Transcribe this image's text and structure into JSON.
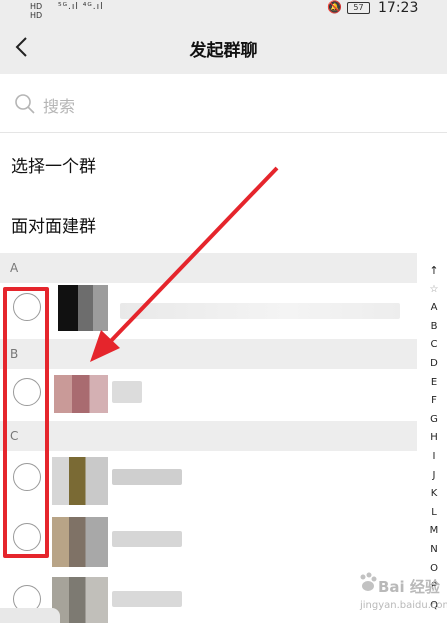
{
  "status_bar": {
    "left_labels": "HD\nHD",
    "signal": "⁵ᴳ.ıl ⁴ᴳ.ıl",
    "battery": "57",
    "time": "17:23"
  },
  "nav": {
    "title": "发起群聊"
  },
  "search": {
    "placeholder": "搜索"
  },
  "menu": {
    "select_group": "选择一个群",
    "face_to_face": "面对面建群"
  },
  "sections": [
    "A",
    "B",
    "C"
  ],
  "index_bar": [
    "↑",
    "☆",
    "A",
    "B",
    "C",
    "D",
    "E",
    "F",
    "G",
    "H",
    "I",
    "J",
    "K",
    "L",
    "M",
    "N",
    "O",
    "P",
    "Q"
  ],
  "watermark": {
    "text": "Bai 经验",
    "sub": "jingyan.baidu.com"
  },
  "colors": {
    "annotation_red": "#e5252c",
    "header_bg": "#ededed"
  }
}
